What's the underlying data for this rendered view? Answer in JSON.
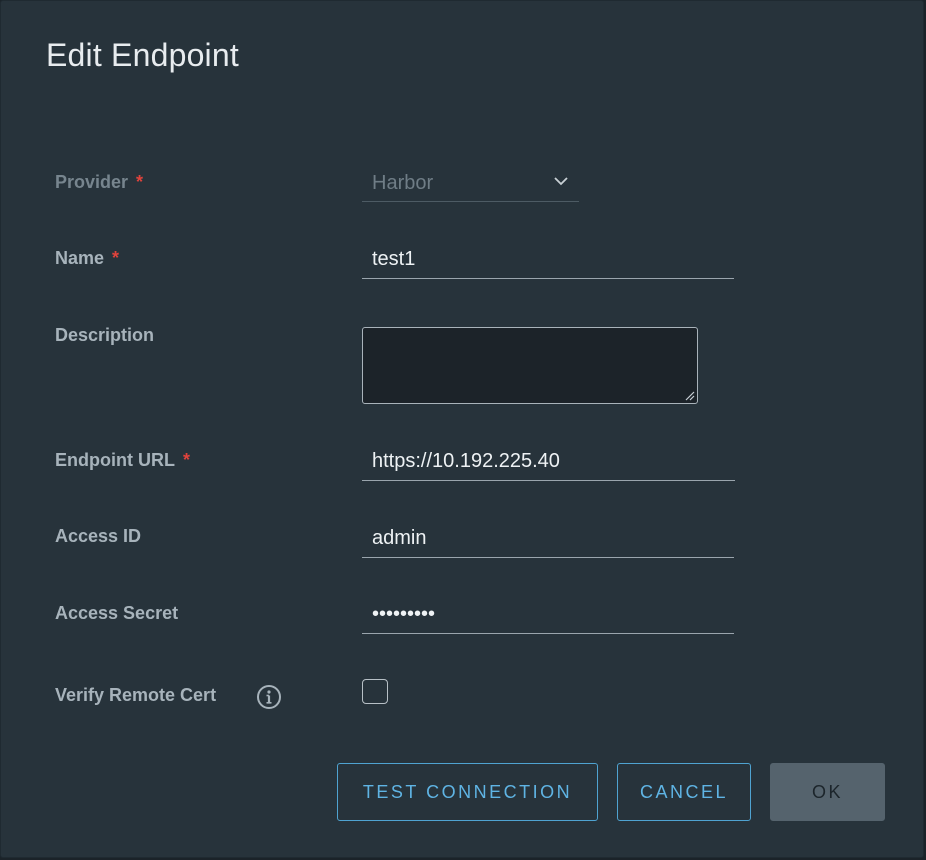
{
  "dialog": {
    "title": "Edit Endpoint"
  },
  "form": {
    "required_marker": "*",
    "provider": {
      "label": "Provider",
      "value": "Harbor"
    },
    "name": {
      "label": "Name",
      "value": "test1"
    },
    "description": {
      "label": "Description",
      "value": ""
    },
    "endpoint_url": {
      "label": "Endpoint URL",
      "value": "https://10.192.225.40"
    },
    "access_id": {
      "label": "Access ID",
      "value": "admin"
    },
    "access_secret": {
      "label": "Access Secret",
      "value": "•••••••••"
    },
    "verify_remote_cert": {
      "label": "Verify Remote Cert",
      "checked": false
    }
  },
  "buttons": {
    "test_connection": "TEST CONNECTION",
    "cancel": "CANCEL",
    "ok": "OK"
  },
  "colors": {
    "dialog_background": "#27333b",
    "accent": "#5fb4e4",
    "required": "#e0433c",
    "ok_disabled": "#55636d"
  },
  "icons": {
    "provider_dropdown": "chevron-down-icon",
    "verify_cert_help": "info-icon",
    "textarea_resize": "resize-grip-icon"
  }
}
